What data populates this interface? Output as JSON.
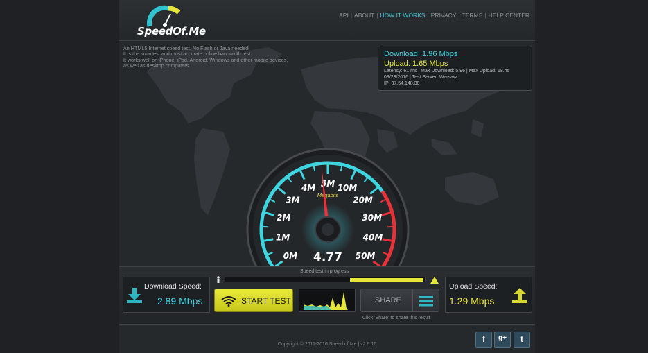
{
  "logo": {
    "text": "SpeedOf.Me"
  },
  "nav": {
    "items": [
      "API",
      "ABOUT",
      "HOW IT WORKS",
      "PRIVACY",
      "TERMS",
      "HELP CENTER"
    ],
    "active_index": 2
  },
  "intro": {
    "lines": [
      "An HTML5 Internet speed test. No Flash or Java needed!",
      "It is the smartest and most accurate online bandwidth test.",
      "It works well on iPhone, iPad, Android, Windows and other mobile devices,",
      "as well as desktop computers."
    ]
  },
  "results": {
    "download": "Download: 1.96 Mbps",
    "upload": "Upload: 1.65 Mbps",
    "stats": "Latency: 61 ms | Max Download: 5.96 | Max Upload: 18.45",
    "date_server": "09/23/2016 | Test Server: Warsaw",
    "ip": "IP: 37.54.148.38"
  },
  "gauge": {
    "labels": [
      "0M",
      "1M",
      "2M",
      "3M",
      "4M",
      "5M",
      "10M",
      "20M",
      "30M",
      "40M",
      "50M"
    ],
    "unit": "Megabits",
    "value": "4.77",
    "needle_value_mbps": 4.77
  },
  "panel": {
    "progress_label": "Speed test in progress",
    "progress_fraction": 0.38,
    "download_label": "Download Speed:",
    "download_value": "2.89 Mbps",
    "upload_label": "Upload Speed:",
    "upload_value": "1.29 Mbps",
    "start_label": "START TEST",
    "share_label": "SHARE",
    "share_hint": "Click 'Share' to share this result"
  },
  "footer": {
    "copyright": "Copyright © 2011-2016 Speed of Me | v2.9.16"
  },
  "social": {
    "facebook": "f",
    "google": "g+",
    "twitter": "t"
  },
  "colors": {
    "accent_cyan": "#3ed4e0",
    "accent_yellow": "#e6e63a",
    "danger_red": "#e8323a"
  },
  "icons": [
    "download-arrow-icon",
    "upload-arrow-icon",
    "wifi-icon",
    "menu-icon",
    "runner-icon",
    "warning-icon"
  ]
}
